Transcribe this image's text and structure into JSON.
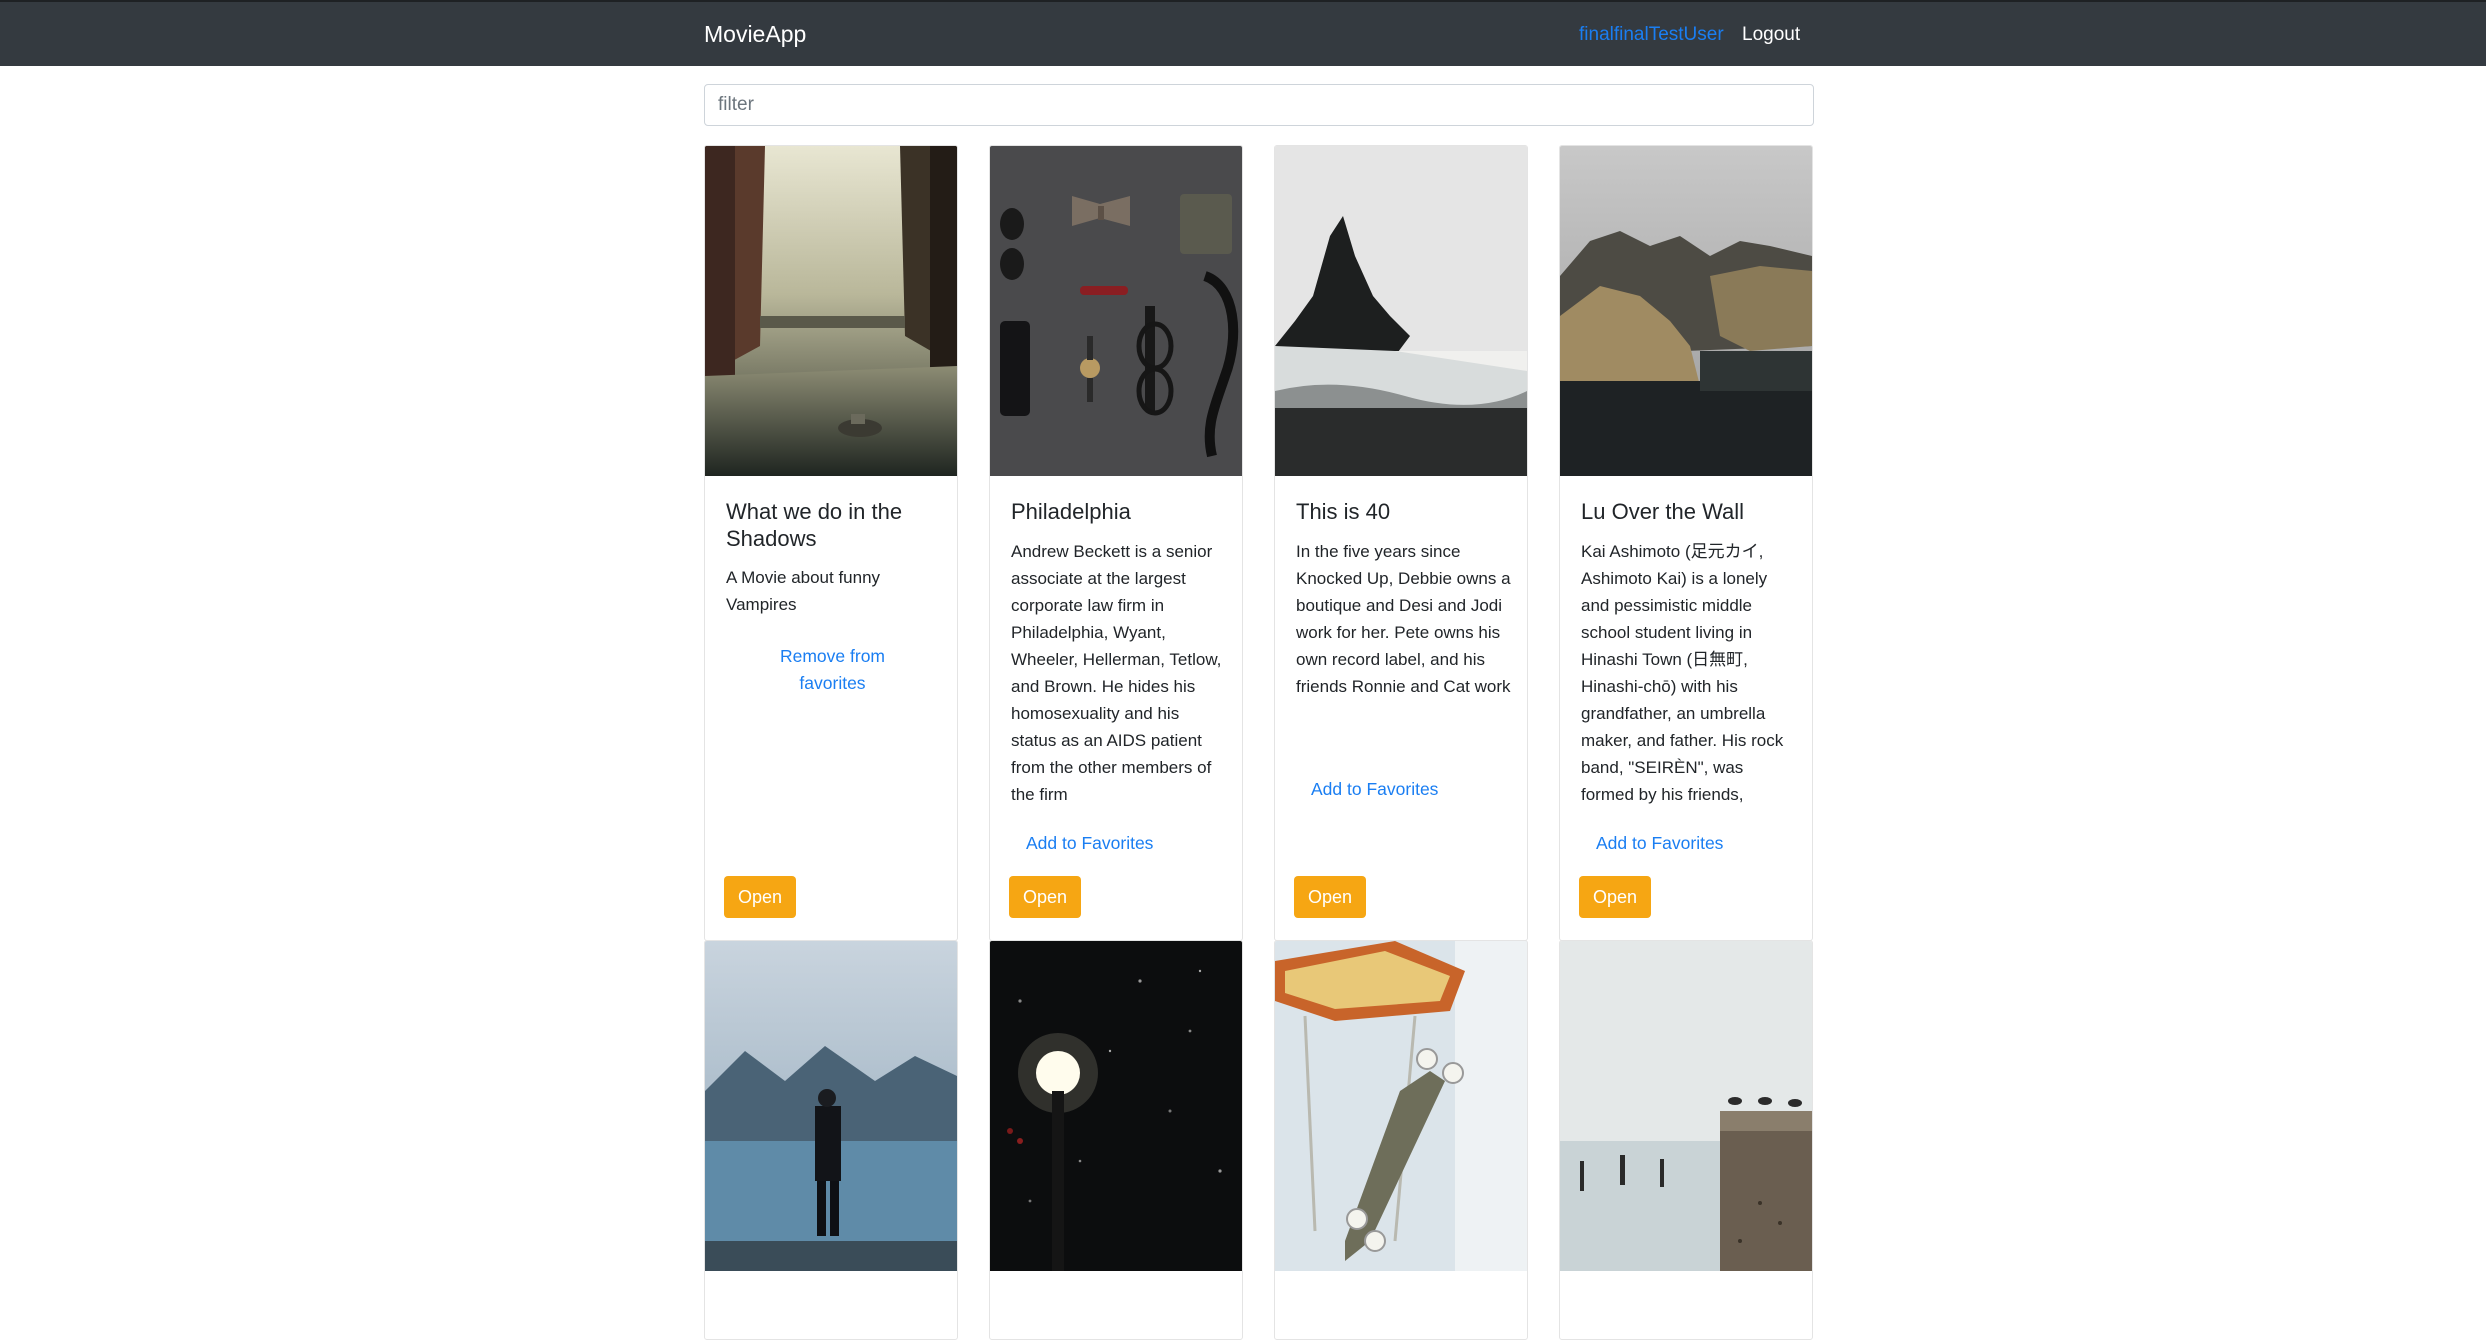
{
  "nav": {
    "brand": "MovieApp",
    "user": "finalfinalTestUser",
    "logout": "Logout"
  },
  "filter": {
    "placeholder": "filter",
    "value": ""
  },
  "cards": [
    {
      "title": "What we do in the Shadows",
      "description": "A Movie about funny Vampires",
      "favorite_label": "Remove from favorites",
      "open_label": "Open"
    },
    {
      "title": "Philadelphia",
      "description": "Andrew Beckett is a senior associate at the largest corporate law firm in Philadelphia, Wyant, Wheeler, Hellerman, Tetlow, and Brown. He hides his homosexuality and his status as an AIDS patient from the other members of the firm",
      "favorite_label": "Add to Favorites",
      "open_label": "Open"
    },
    {
      "title": "This is 40",
      "description": "In the five years since Knocked Up, Debbie owns a boutique and Desi and Jodi work for her. Pete owns his own record label, and his friends Ronnie and Cat work with him.",
      "favorite_label": "Add to Favorites",
      "open_label": "Open"
    },
    {
      "title": "Lu Over the Wall",
      "description": "Kai Ashimoto (足元カイ, Ashimoto Kai) is a lonely and pessimistic middle school student living in Hinashi Town (日無町, Hinashi-chō) with his grandfather, an umbrella maker, and father. His rock band, \"SEIRÈN\", was formed by his friends,",
      "favorite_label": "Add to Favorites",
      "open_label": "Open"
    }
  ]
}
